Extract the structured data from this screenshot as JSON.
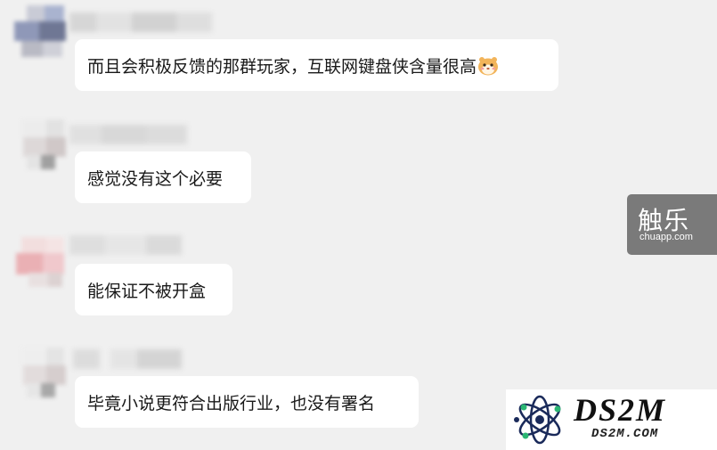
{
  "messages": [
    {
      "text": "而且会积极反馈的那群玩家，互联网键盘侠含量很高",
      "emoji": "hamster-face-emoji"
    },
    {
      "text": "感觉没有这个必要"
    },
    {
      "text": "能保证不被开盒"
    },
    {
      "text": "毕竟小说更符合出版行业，也没有署名"
    }
  ],
  "watermarks": {
    "chuapp_name": "触乐",
    "chuapp_domain": "chuapp.com",
    "ds2m_name": "DS2M",
    "ds2m_domain": "DS2M.COM"
  },
  "colors": {
    "background": "#f0f0f0",
    "bubble": "#ffffff",
    "text": "#191919",
    "watermark_bg": "#7a7a7a"
  }
}
